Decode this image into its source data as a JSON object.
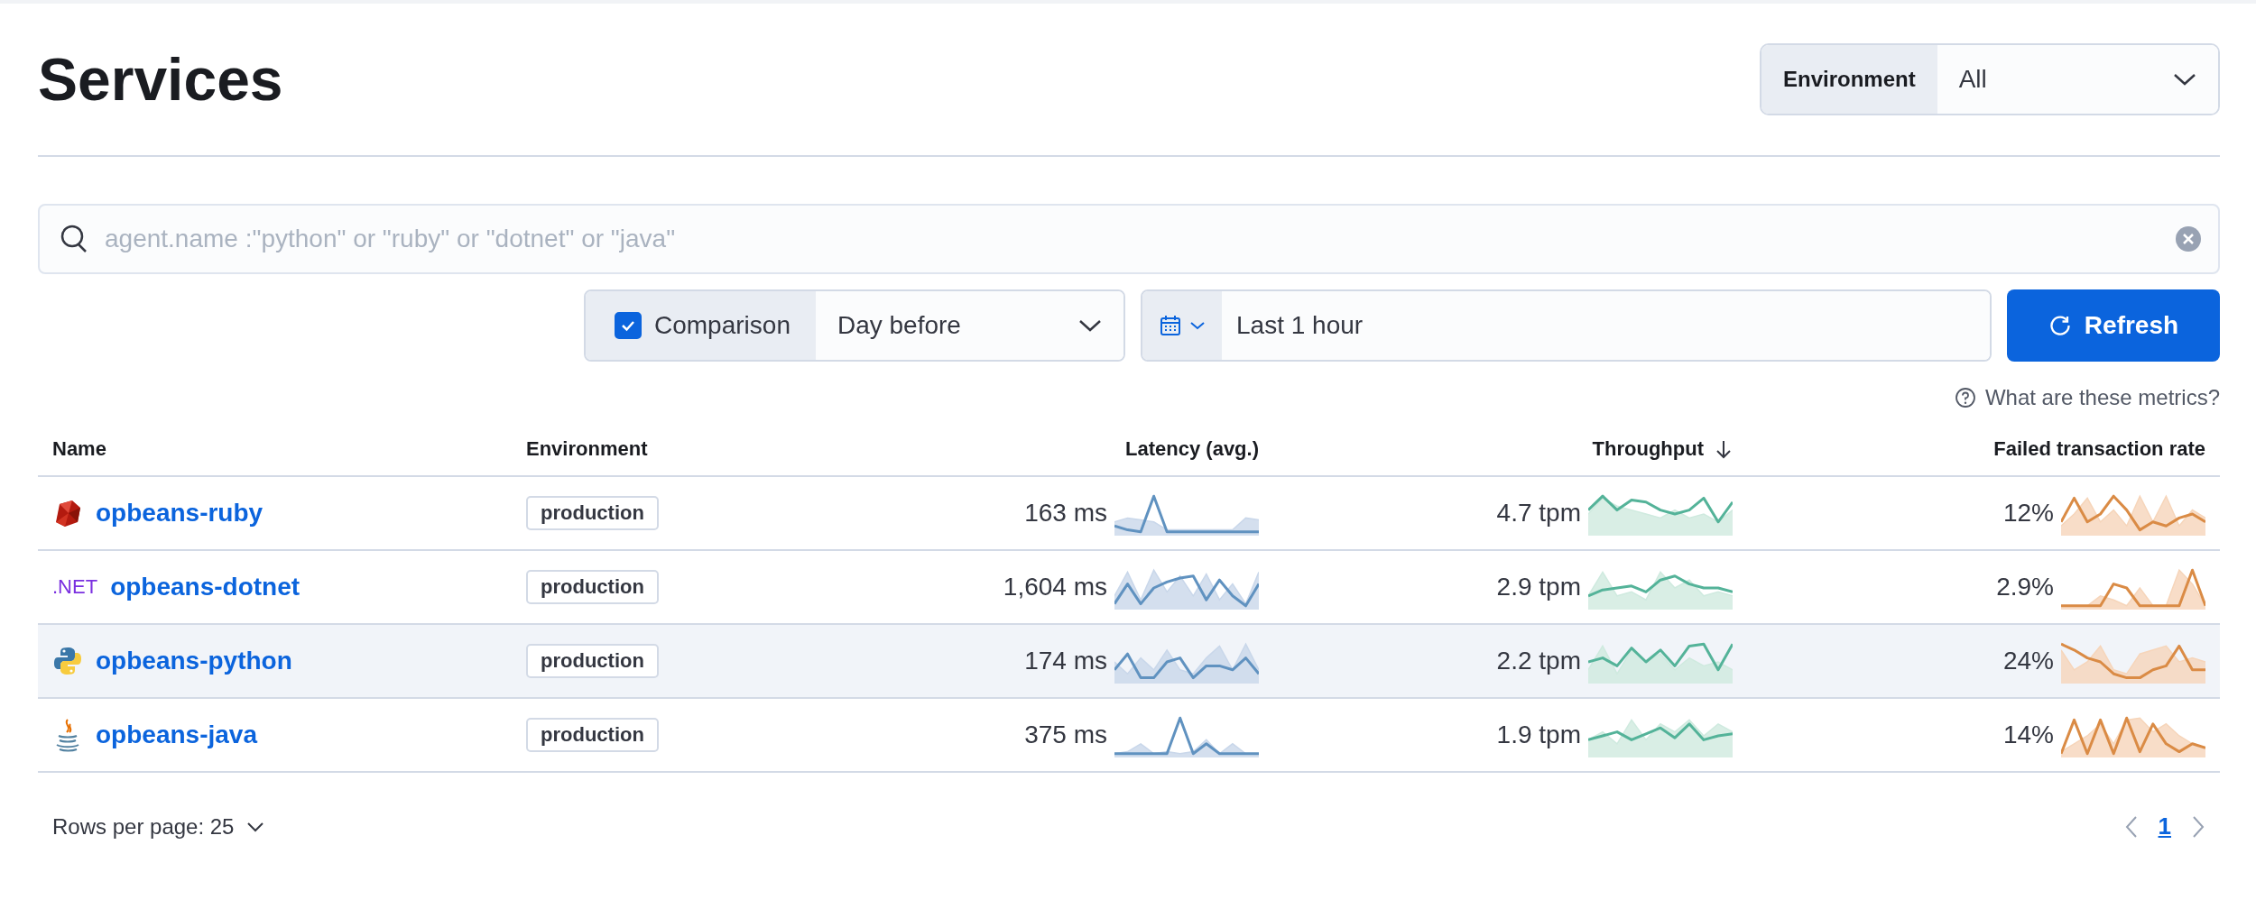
{
  "title": "Services",
  "environment_select": {
    "label": "Environment",
    "value": "All"
  },
  "search": {
    "placeholder": "agent.name :\"python\" or \"ruby\" or \"dotnet\" or \"java\""
  },
  "comparison": {
    "label": "Comparison",
    "checked": true,
    "value": "Day before"
  },
  "date_picker": {
    "value": "Last 1 hour"
  },
  "refresh_button": "Refresh",
  "metrics_help": "What are these metrics?",
  "table": {
    "columns": [
      {
        "label": "Name"
      },
      {
        "label": "Environment"
      },
      {
        "label": "Latency (avg.)"
      },
      {
        "label": "Throughput",
        "sorted": true
      },
      {
        "label": "Failed transaction rate"
      }
    ],
    "rows": [
      {
        "agent": {
          "kind": "ruby"
        },
        "name": "opbeans-ruby",
        "environment": "production",
        "latency": "163 ms",
        "throughput": "4.7 tpm",
        "failed_rate": "12%",
        "hovered": false
      },
      {
        "agent": {
          "kind": "text",
          "text": ".NET"
        },
        "name": "opbeans-dotnet",
        "environment": "production",
        "latency": "1,604 ms",
        "throughput": "2.9 tpm",
        "failed_rate": "2.9%",
        "hovered": false
      },
      {
        "agent": {
          "kind": "python"
        },
        "name": "opbeans-python",
        "environment": "production",
        "latency": "174 ms",
        "throughput": "2.2 tpm",
        "failed_rate": "24%",
        "hovered": true
      },
      {
        "agent": {
          "kind": "java"
        },
        "name": "opbeans-java",
        "environment": "production",
        "latency": "375 ms",
        "throughput": "1.9 tpm",
        "failed_rate": "14%",
        "hovered": false
      }
    ]
  },
  "footer": {
    "rows_per_page": "Rows per page: 25",
    "pages": [
      {
        "label": "1",
        "selected": true
      }
    ]
  }
}
